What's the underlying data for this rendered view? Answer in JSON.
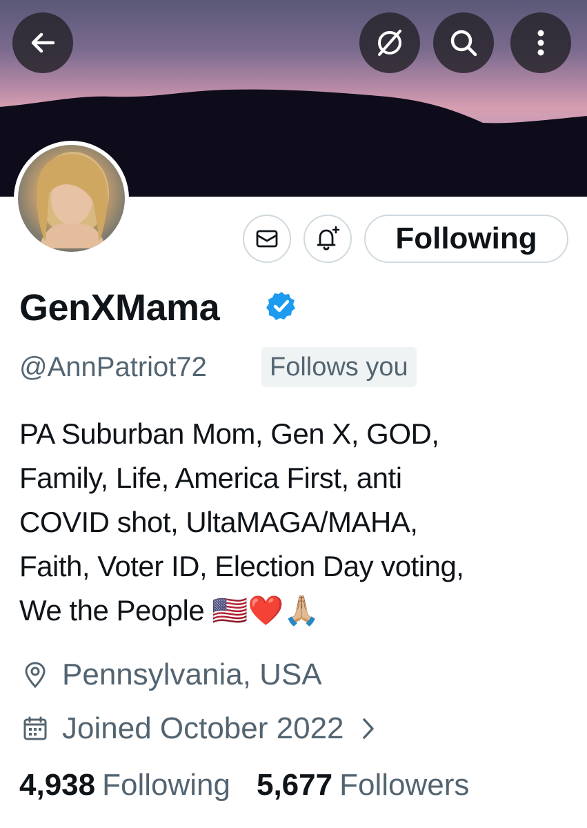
{
  "header": {
    "back_icon": "arrow-left-icon",
    "actions": [
      "grok-icon",
      "search-icon",
      "more-vertical-icon"
    ]
  },
  "profile": {
    "display_name": "GenXMama",
    "verified": true,
    "verified_color": "#1d9bf0",
    "handle": "@AnnPatriot72",
    "follows_you_label": "Follows you",
    "bio_lines": [
      "PA Suburban Mom, Gen X, GOD,",
      "Family, Life, America First, anti",
      "COVID shot, UltaMAGA/MAHA,",
      "Faith, Voter ID, Election Day voting,",
      "We the People 🇺🇸❤️🙏🏼"
    ],
    "location": "Pennsylvania, USA",
    "joined": "Joined October 2022",
    "following_count": "4,938",
    "following_label": "Following",
    "followers_count": "5,677",
    "followers_label": "Followers"
  },
  "actions": {
    "message_icon": "envelope-icon",
    "notify_icon": "bell-plus-icon",
    "follow_state_label": "Following"
  }
}
